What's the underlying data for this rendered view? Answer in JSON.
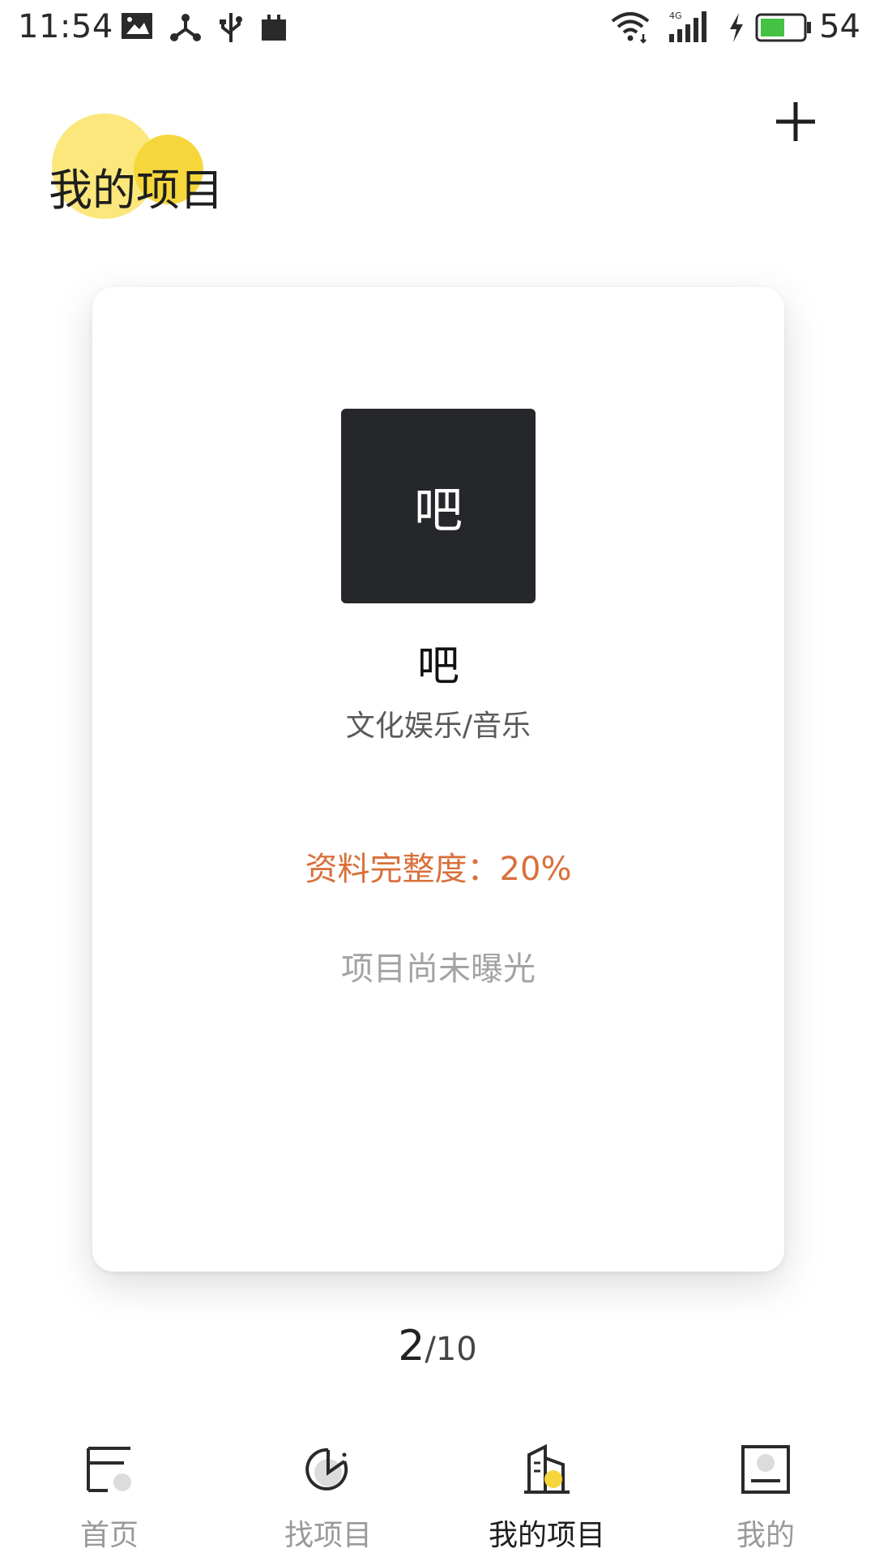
{
  "status_bar": {
    "time": "11:54",
    "network": "4G",
    "battery_level": "54",
    "icons": [
      "gallery-icon",
      "share-icon",
      "usb-icon",
      "notification-icon",
      "wifi-icon",
      "cell-signal-icon",
      "charging-icon",
      "battery-icon"
    ]
  },
  "header": {
    "title": "我的项目",
    "add_icon": "plus-icon"
  },
  "card": {
    "avatar_char": "吧",
    "project_name": "吧",
    "category": "文化娱乐/音乐",
    "completeness_label": "资料完整度：20%",
    "exposure_status": "项目尚未曝光"
  },
  "pager": {
    "current": "2",
    "separator": "/",
    "total": "10"
  },
  "bottom_nav": {
    "items": [
      {
        "label": "首页",
        "icon": "home-icon",
        "active": false
      },
      {
        "label": "找项目",
        "icon": "find-project-icon",
        "active": false
      },
      {
        "label": "我的项目",
        "icon": "my-projects-icon",
        "active": true
      },
      {
        "label": "我的",
        "icon": "profile-icon",
        "active": false
      }
    ]
  },
  "colors": {
    "accent_yellow": "#f6d73b",
    "accent_yellow_light": "#fbe77c",
    "completeness_orange": "#d9703b",
    "muted_gray": "#a3a3a3",
    "tile_dark": "#26272b"
  }
}
